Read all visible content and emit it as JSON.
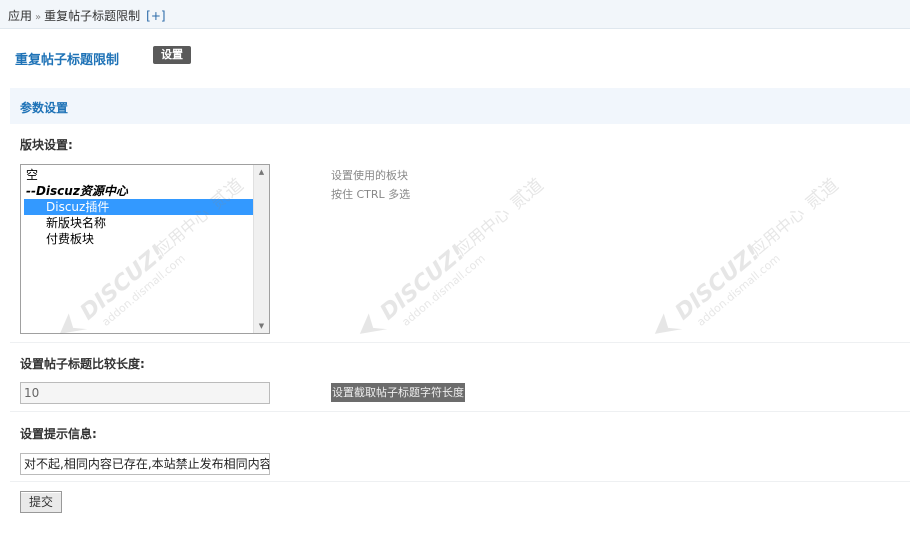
{
  "breadcrumb": {
    "root": "应用",
    "current": "重复帖子标题限制",
    "add": "[+]"
  },
  "page": {
    "title": "重复帖子标题限制",
    "settings_button": "设置"
  },
  "section": {
    "title": "参数设置"
  },
  "forum_setting": {
    "label": "版块设置:",
    "options": [
      "空",
      "--Discuz资源中心",
      "Discuz插件",
      "新版块名称",
      "付费板块"
    ],
    "selected": "Discuz插件",
    "hint_line1": "设置使用的板块",
    "hint_line2": "按住 CTRL 多选"
  },
  "title_length": {
    "label": "设置帖子标题比较长度:",
    "value": "10",
    "hint": "设置截取帖子标题字符长度"
  },
  "prompt_info": {
    "label": "设置提示信息:",
    "value": "对不起,相同内容已存在,本站禁止发布相同内容"
  },
  "submit_label": "提交",
  "watermark": {
    "brand": "DISCUZ!",
    "cn": "应用中心",
    "url": "addon.dismall.com",
    "cn2": "贰道"
  }
}
